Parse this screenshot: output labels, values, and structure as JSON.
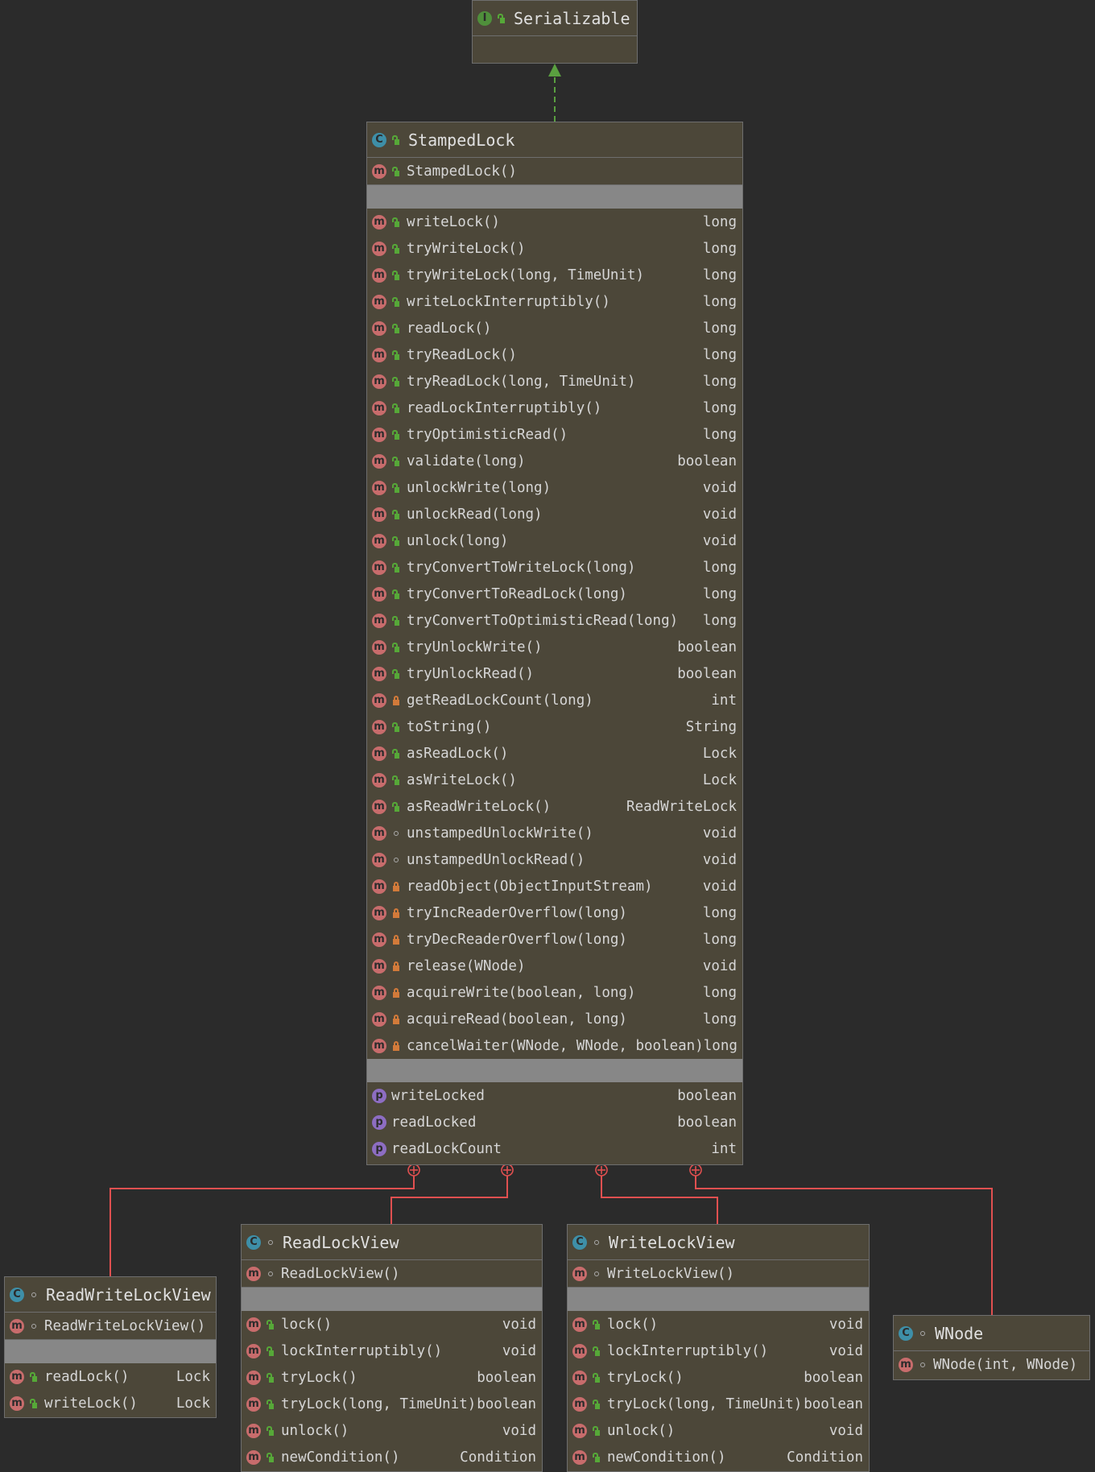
{
  "interface_box": {
    "name": "Serializable",
    "icon": "interface-icon"
  },
  "main": {
    "name": "StampedLock",
    "constructors": [
      {
        "name": "StampedLock()",
        "vis": "pub"
      }
    ],
    "methods": [
      {
        "name": "writeLock()",
        "type": "long",
        "vis": "pub"
      },
      {
        "name": "tryWriteLock()",
        "type": "long",
        "vis": "pub"
      },
      {
        "name": "tryWriteLock(long, TimeUnit)",
        "type": "long",
        "vis": "pub"
      },
      {
        "name": "writeLockInterruptibly()",
        "type": "long",
        "vis": "pub"
      },
      {
        "name": "readLock()",
        "type": "long",
        "vis": "pub"
      },
      {
        "name": "tryReadLock()",
        "type": "long",
        "vis": "pub"
      },
      {
        "name": "tryReadLock(long, TimeUnit)",
        "type": "long",
        "vis": "pub"
      },
      {
        "name": "readLockInterruptibly()",
        "type": "long",
        "vis": "pub"
      },
      {
        "name": "tryOptimisticRead()",
        "type": "long",
        "vis": "pub"
      },
      {
        "name": "validate(long)",
        "type": "boolean",
        "vis": "pub"
      },
      {
        "name": "unlockWrite(long)",
        "type": "void",
        "vis": "pub"
      },
      {
        "name": "unlockRead(long)",
        "type": "void",
        "vis": "pub"
      },
      {
        "name": "unlock(long)",
        "type": "void",
        "vis": "pub"
      },
      {
        "name": "tryConvertToWriteLock(long)",
        "type": "long",
        "vis": "pub"
      },
      {
        "name": "tryConvertToReadLock(long)",
        "type": "long",
        "vis": "pub"
      },
      {
        "name": "tryConvertToOptimisticRead(long)",
        "type": "long",
        "vis": "pub"
      },
      {
        "name": "tryUnlockWrite()",
        "type": "boolean",
        "vis": "pub"
      },
      {
        "name": "tryUnlockRead()",
        "type": "boolean",
        "vis": "pub"
      },
      {
        "name": "getReadLockCount(long)",
        "type": "int",
        "vis": "priv"
      },
      {
        "name": "toString()",
        "type": "String",
        "vis": "pub"
      },
      {
        "name": "asReadLock()",
        "type": "Lock",
        "vis": "pub"
      },
      {
        "name": "asWriteLock()",
        "type": "Lock",
        "vis": "pub"
      },
      {
        "name": "asReadWriteLock()",
        "type": "ReadWriteLock",
        "vis": "pub"
      },
      {
        "name": "unstampedUnlockWrite()",
        "type": "void",
        "vis": "pkg"
      },
      {
        "name": "unstampedUnlockRead()",
        "type": "void",
        "vis": "pkg"
      },
      {
        "name": "readObject(ObjectInputStream)",
        "type": "void",
        "vis": "priv"
      },
      {
        "name": "tryIncReaderOverflow(long)",
        "type": "long",
        "vis": "priv"
      },
      {
        "name": "tryDecReaderOverflow(long)",
        "type": "long",
        "vis": "priv"
      },
      {
        "name": "release(WNode)",
        "type": "void",
        "vis": "priv"
      },
      {
        "name": "acquireWrite(boolean, long)",
        "type": "long",
        "vis": "priv"
      },
      {
        "name": "acquireRead(boolean, long)",
        "type": "long",
        "vis": "priv"
      },
      {
        "name": "cancelWaiter(WNode, WNode, boolean)",
        "type": "long",
        "vis": "priv"
      }
    ],
    "properties": [
      {
        "name": "writeLocked",
        "type": "boolean"
      },
      {
        "name": "readLocked",
        "type": "boolean"
      },
      {
        "name": "readLockCount",
        "type": "int"
      }
    ]
  },
  "rwlv": {
    "name": "ReadWriteLockView",
    "constructors": [
      {
        "name": "ReadWriteLockView()",
        "vis": "pkg"
      }
    ],
    "methods": [
      {
        "name": "readLock()",
        "type": "Lock",
        "vis": "pub"
      },
      {
        "name": "writeLock()",
        "type": "Lock",
        "vis": "pub"
      }
    ]
  },
  "rlv": {
    "name": "ReadLockView",
    "constructors": [
      {
        "name": "ReadLockView()",
        "vis": "pkg"
      }
    ],
    "methods": [
      {
        "name": "lock()",
        "type": "void",
        "vis": "pub"
      },
      {
        "name": "lockInterruptibly()",
        "type": "void",
        "vis": "pub"
      },
      {
        "name": "tryLock()",
        "type": "boolean",
        "vis": "pub"
      },
      {
        "name": "tryLock(long, TimeUnit)",
        "type": "boolean",
        "vis": "pub"
      },
      {
        "name": "unlock()",
        "type": "void",
        "vis": "pub"
      },
      {
        "name": "newCondition()",
        "type": "Condition",
        "vis": "pub"
      }
    ]
  },
  "wlv": {
    "name": "WriteLockView",
    "constructors": [
      {
        "name": "WriteLockView()",
        "vis": "pkg"
      }
    ],
    "methods": [
      {
        "name": "lock()",
        "type": "void",
        "vis": "pub"
      },
      {
        "name": "lockInterruptibly()",
        "type": "void",
        "vis": "pub"
      },
      {
        "name": "tryLock()",
        "type": "boolean",
        "vis": "pub"
      },
      {
        "name": "tryLock(long, TimeUnit)",
        "type": "boolean",
        "vis": "pub"
      },
      {
        "name": "unlock()",
        "type": "void",
        "vis": "pub"
      },
      {
        "name": "newCondition()",
        "type": "Condition",
        "vis": "pub"
      }
    ]
  },
  "wnode": {
    "name": "WNode",
    "constructors": [
      {
        "name": "WNode(int, WNode)",
        "vis": "pkg"
      }
    ]
  },
  "icons": {
    "class": "C",
    "method": "m",
    "interface": "I",
    "property": "p"
  },
  "colors": {
    "background": "#2b2b2b",
    "box_fill": "#4c4739",
    "separator": "#878787",
    "inner_class_link": "#e05050",
    "implements_link": "#5aa040"
  }
}
